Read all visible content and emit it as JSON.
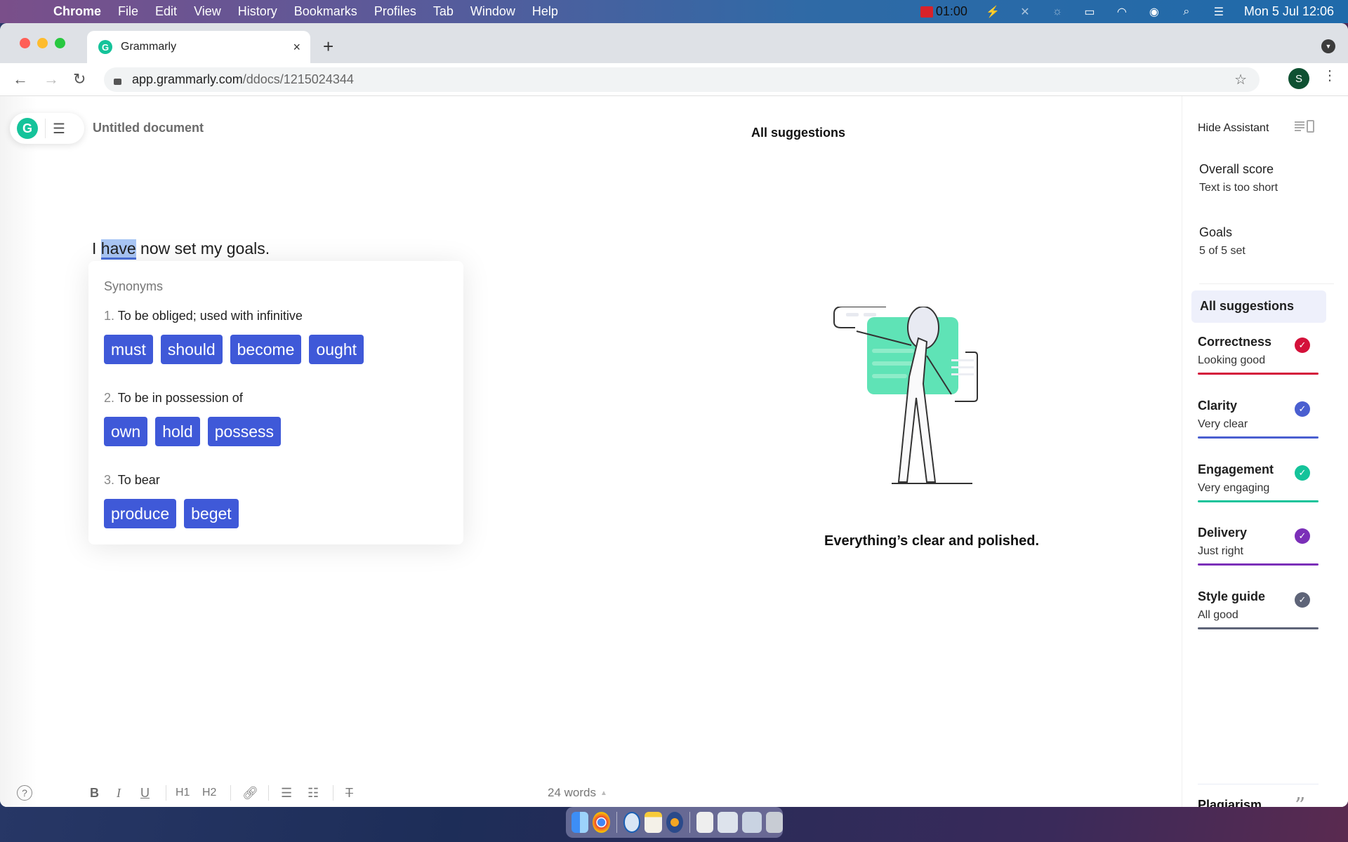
{
  "menubar": {
    "app": "Chrome",
    "items": [
      "File",
      "Edit",
      "View",
      "History",
      "Bookmarks",
      "Profiles",
      "Tab",
      "Window",
      "Help"
    ],
    "recording_time": "01:00",
    "datetime": "Mon 5 Jul  12:06"
  },
  "browser": {
    "tab_title": "Grammarly",
    "url_host": "app.grammarly.com",
    "url_path": "/ddocs/1215024344",
    "profile_initial": "S"
  },
  "doc": {
    "title": "Untitled document",
    "text_before": "I ",
    "text_selected": "have",
    "text_after": " now set my goals."
  },
  "synonyms": {
    "header": "Synonyms",
    "senses": [
      {
        "num": "1.",
        "definition": "To be obliged; used with infinitive",
        "words": [
          "must",
          "should",
          "become",
          "ought"
        ]
      },
      {
        "num": "2.",
        "definition": "To be in possession of",
        "words": [
          "own",
          "hold",
          "possess"
        ]
      },
      {
        "num": "3.",
        "definition": "To bear",
        "words": [
          "produce",
          "beget"
        ]
      }
    ]
  },
  "main": {
    "heading": "All suggestions",
    "empty_message": "Everything’s clear and polished."
  },
  "sidebar": {
    "hide_assistant": "Hide Assistant",
    "overall_score_label": "Overall score",
    "overall_score_value": "Text is too short",
    "goals_label": "Goals",
    "goals_value": "5 of 5 set",
    "active_item": "All suggestions",
    "categories": [
      {
        "name": "Correctness",
        "status": "Looking good",
        "color": "#d4113a"
      },
      {
        "name": "Clarity",
        "status": "Very clear",
        "color": "#4a5fd0"
      },
      {
        "name": "Engagement",
        "status": "Very engaging",
        "color": "#15c39a"
      },
      {
        "name": "Delivery",
        "status": "Just right",
        "color": "#7b2fb8"
      },
      {
        "name": "Style guide",
        "status": "All good",
        "color": "#5e6478"
      }
    ],
    "plagiarism": "Plagiarism"
  },
  "bottom": {
    "word_count": "24 words",
    "format_tools": [
      "bold",
      "italic",
      "underline",
      "h1",
      "h2",
      "link",
      "numbered-list",
      "bulleted-list",
      "clear-formatting"
    ],
    "labels": {
      "bold": "B",
      "italic": "I",
      "underline": "U",
      "h1": "H1",
      "h2": "H2"
    }
  }
}
